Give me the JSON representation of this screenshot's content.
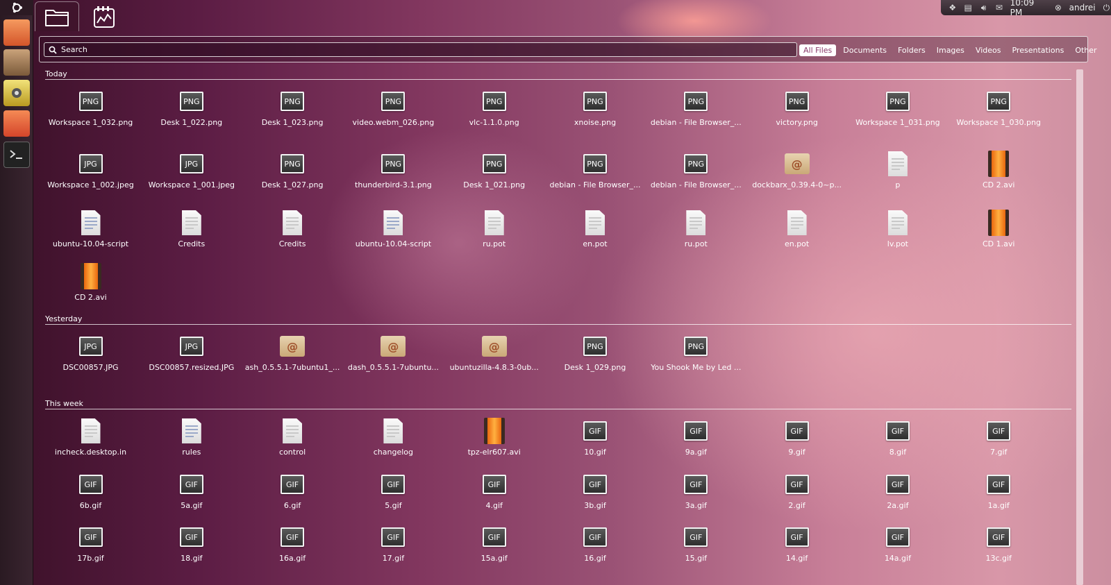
{
  "panel": {
    "clock": "10:09 PM",
    "user": "andrei",
    "icons": [
      "dropbox-icon",
      "clipboard-icon",
      "volume-icon",
      "mail-icon"
    ]
  },
  "search": {
    "value": "",
    "placeholder": "Search"
  },
  "filters": [
    "All Files",
    "Documents",
    "Folders",
    "Images",
    "Videos",
    "Presentations",
    "Other"
  ],
  "active_filter": "All Files",
  "sections": {
    "today": "Today",
    "yesterday": "Yesterday",
    "this_week": "This week"
  },
  "today_files": [
    {
      "name": "Workspace 1_032.png",
      "kind": "PNG"
    },
    {
      "name": "Desk 1_022.png",
      "kind": "PNG"
    },
    {
      "name": "Desk 1_023.png",
      "kind": "PNG"
    },
    {
      "name": "video.webm_026.png",
      "kind": "PNG"
    },
    {
      "name": "vlc-1.1.0.png",
      "kind": "PNG"
    },
    {
      "name": "xnoise.png",
      "kind": "PNG"
    },
    {
      "name": "debian - File Browser_...",
      "kind": "PNG"
    },
    {
      "name": "victory.png",
      "kind": "PNG"
    },
    {
      "name": "Workspace 1_031.png",
      "kind": "PNG"
    },
    {
      "name": "Workspace 1_030.png",
      "kind": "PNG"
    },
    {
      "name": "Workspace 1_002.jpeg",
      "kind": "JPG"
    },
    {
      "name": "Workspace 1_001.jpeg",
      "kind": "JPG"
    },
    {
      "name": "Desk 1_027.png",
      "kind": "PNG"
    },
    {
      "name": "thunderbird-3.1.png",
      "kind": "PNG"
    },
    {
      "name": "Desk 1_021.png",
      "kind": "PNG"
    },
    {
      "name": "debian - File Browser_...",
      "kind": "PNG"
    },
    {
      "name": "debian - File Browser_...",
      "kind": "PNG"
    },
    {
      "name": "dockbarx_0.39.4-0~p...",
      "kind": "pkg"
    },
    {
      "name": "p",
      "kind": "doc"
    },
    {
      "name": "CD 2.avi",
      "kind": "video"
    },
    {
      "name": "ubuntu-10.04-script",
      "kind": "script"
    },
    {
      "name": "Credits",
      "kind": "doc"
    },
    {
      "name": "Credits",
      "kind": "doc"
    },
    {
      "name": "ubuntu-10.04-script",
      "kind": "script"
    },
    {
      "name": "ru.pot",
      "kind": "doc"
    },
    {
      "name": "en.pot",
      "kind": "doc"
    },
    {
      "name": "ru.pot",
      "kind": "doc"
    },
    {
      "name": "en.pot",
      "kind": "doc"
    },
    {
      "name": "lv.pot",
      "kind": "doc"
    },
    {
      "name": "CD 1.avi",
      "kind": "video"
    },
    {
      "name": "CD 2.avi",
      "kind": "video"
    }
  ],
  "yesterday_files": [
    {
      "name": "DSC00857.JPG",
      "kind": "JPG"
    },
    {
      "name": "DSC00857.resized.JPG",
      "kind": "JPG"
    },
    {
      "name": "ash_0.5.5.1-7ubuntu1_...",
      "kind": "pkg"
    },
    {
      "name": "dash_0.5.5.1-7ubuntu...",
      "kind": "pkg"
    },
    {
      "name": "ubuntuzilla-4.8.3-0ub...",
      "kind": "pkg"
    },
    {
      "name": "Desk 1_029.png",
      "kind": "PNG"
    },
    {
      "name": "You Shook Me by Led ...",
      "kind": "PNG"
    }
  ],
  "week_files": [
    {
      "name": "incheck.desktop.in",
      "kind": "doc"
    },
    {
      "name": "rules",
      "kind": "script"
    },
    {
      "name": "control",
      "kind": "doc"
    },
    {
      "name": "changelog",
      "kind": "doc"
    },
    {
      "name": "tpz-elr607.avi",
      "kind": "video"
    },
    {
      "name": "10.gif",
      "kind": "GIF"
    },
    {
      "name": "9a.gif",
      "kind": "GIF"
    },
    {
      "name": "9.gif",
      "kind": "GIF"
    },
    {
      "name": "8.gif",
      "kind": "GIF"
    },
    {
      "name": "7.gif",
      "kind": "GIF"
    },
    {
      "name": "6b.gif",
      "kind": "GIF"
    },
    {
      "name": "5a.gif",
      "kind": "GIF"
    },
    {
      "name": "6.gif",
      "kind": "GIF"
    },
    {
      "name": "5.gif",
      "kind": "GIF"
    },
    {
      "name": "4.gif",
      "kind": "GIF"
    },
    {
      "name": "3b.gif",
      "kind": "GIF"
    },
    {
      "name": "3a.gif",
      "kind": "GIF"
    },
    {
      "name": "2.gif",
      "kind": "GIF"
    },
    {
      "name": "2a.gif",
      "kind": "GIF"
    },
    {
      "name": "1a.gif",
      "kind": "GIF"
    },
    {
      "name": "17b.gif",
      "kind": "GIF"
    },
    {
      "name": "18.gif",
      "kind": "GIF"
    },
    {
      "name": "16a.gif",
      "kind": "GIF"
    },
    {
      "name": "17.gif",
      "kind": "GIF"
    },
    {
      "name": "15a.gif",
      "kind": "GIF"
    },
    {
      "name": "16.gif",
      "kind": "GIF"
    },
    {
      "name": "15.gif",
      "kind": "GIF"
    },
    {
      "name": "14.gif",
      "kind": "GIF"
    },
    {
      "name": "14a.gif",
      "kind": "GIF"
    },
    {
      "name": "13c.gif",
      "kind": "GIF"
    }
  ],
  "colors": {
    "accent_filter_text": "#8a3a6a",
    "launcher_bg": "#2a1a22"
  }
}
